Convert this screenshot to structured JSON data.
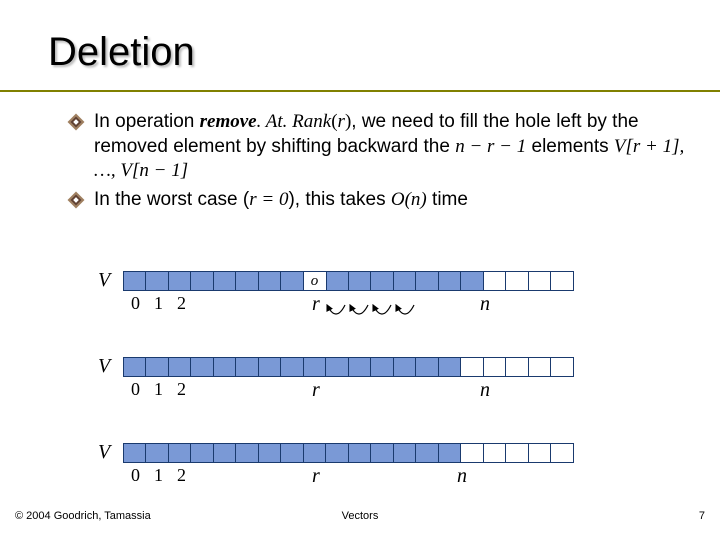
{
  "title": "Deletion",
  "bullets": {
    "b1": {
      "pre": "In operation ",
      "func": "remove",
      "funcRest": ". At. Rank",
      "arg": "r",
      "mid": ", we need to fill the hole left by the removed element by shifting backward the ",
      "expr_nr1": "n − r − 1",
      "post_nr1": " elements ",
      "Vr1": "V[r + 1], …, V[n − 1]"
    },
    "b2": {
      "pre": "In the worst case (",
      "r_eq": "r = 0",
      "mid": "), this takes ",
      "On": "O(n)",
      "post": " time"
    }
  },
  "diagram": {
    "V": "V",
    "hole_o": "o",
    "indices": {
      "i0": "0",
      "i1": "1",
      "i2": "2"
    },
    "r": "r",
    "n": "n"
  },
  "footer": {
    "left": "© 2004 Goodrich, Tamassia",
    "center": "Vectors",
    "page": "7"
  }
}
